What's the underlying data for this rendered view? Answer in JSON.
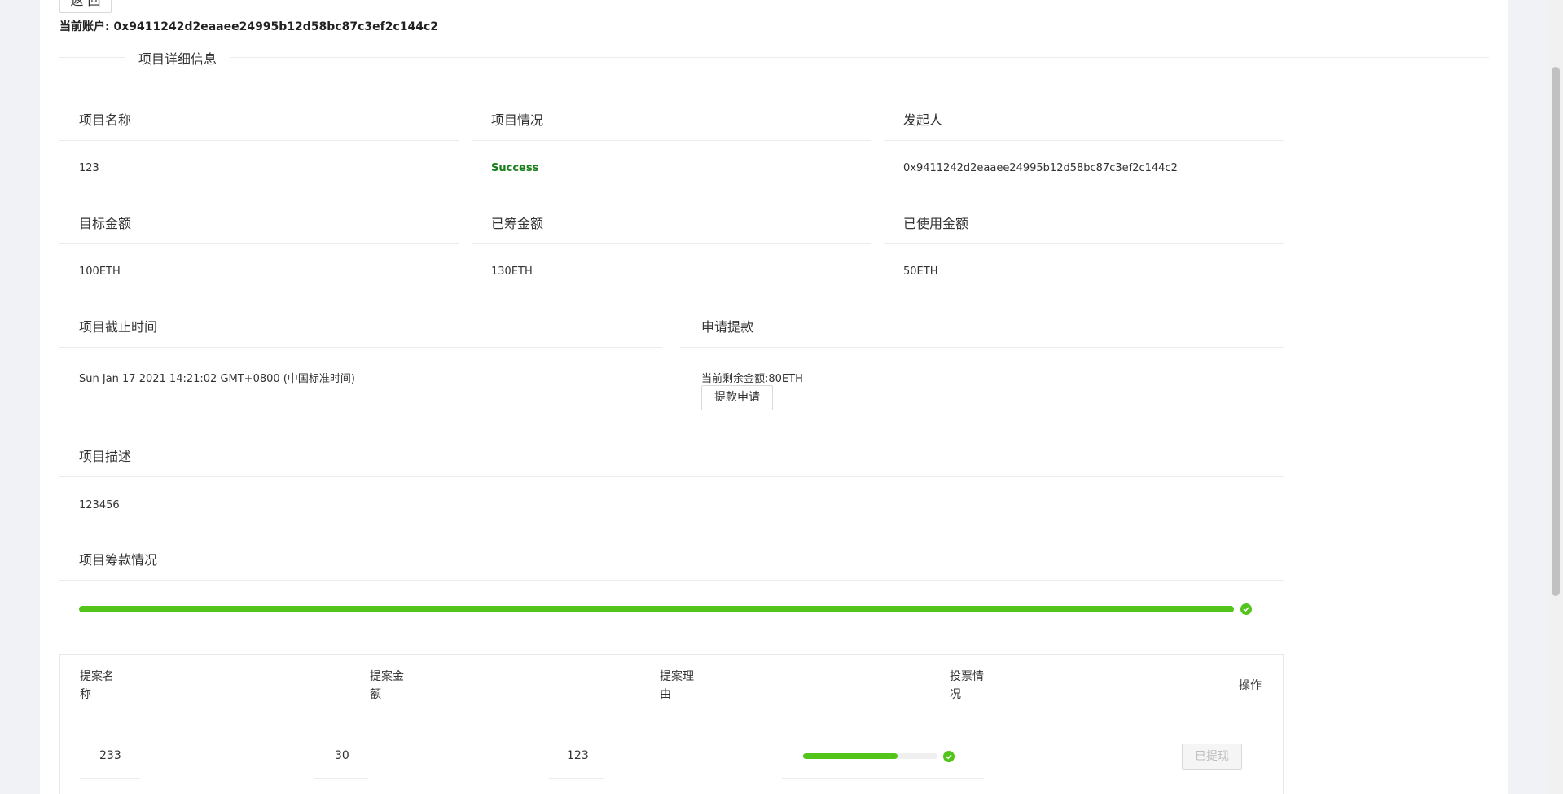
{
  "header": {
    "back_label": "返 回",
    "account_label": "当前账户:",
    "account_address": "0x9411242d2eaaee24995b12d58bc87c3ef2c144c2"
  },
  "section": {
    "title": "项目详细信息"
  },
  "details": {
    "name_label": "项目名称",
    "name_value": "123",
    "status_label": "项目情况",
    "status_value": "Success",
    "initiator_label": "发起人",
    "initiator_value": "0x9411242d2eaaee24995b12d58bc87c3ef2c144c2",
    "target_label": "目标金额",
    "target_value": "100ETH",
    "raised_label": "已筹金额",
    "raised_value": "130ETH",
    "used_label": "已使用金额",
    "used_value": "50ETH",
    "deadline_label": "项目截止时间",
    "deadline_value": "Sun Jan 17 2021 14:21:02 GMT+0800 (中国标准时间)",
    "withdraw_label": "申请提款",
    "remaining_label": "当前剩余金额:",
    "remaining_value": "80ETH",
    "withdraw_button": "提款申请",
    "description_label": "项目描述",
    "description_value": "123456",
    "funding_label": "项目筹款情况",
    "funding_progress": 1.0
  },
  "colors": {
    "success": "#1a7e1a",
    "progress": "#52c41a"
  },
  "table": {
    "headers": [
      "提案名称",
      "提案金额",
      "提案理由",
      "投票情况",
      "操作"
    ],
    "rows": [
      {
        "name": "233",
        "amount": "30",
        "reason": "123",
        "vote_progress": 0.7,
        "action": "已提现"
      }
    ]
  }
}
